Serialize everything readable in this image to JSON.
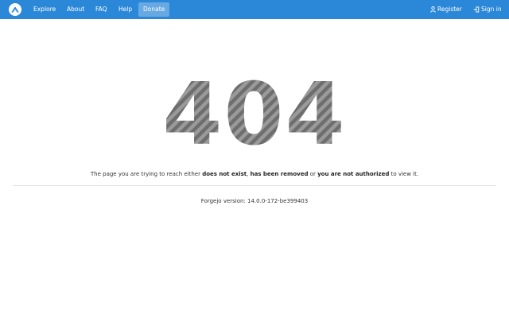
{
  "navbar": {
    "background": "#2b88d8",
    "logo_icon": "forgejo-logo-icon",
    "items": [
      {
        "label": "Explore"
      },
      {
        "label": "About"
      },
      {
        "label": "FAQ"
      },
      {
        "label": "Help"
      },
      {
        "label": "Donate",
        "active": true
      }
    ],
    "register_label": "Register",
    "register_icon": "person-icon",
    "signin_label": "Sign in",
    "signin_icon": "sign-in-icon"
  },
  "error": {
    "code": "404",
    "message_parts": [
      {
        "text": "The page you are trying to reach either ",
        "bold": false
      },
      {
        "text": "does not exist",
        "bold": true
      },
      {
        "text": ", ",
        "bold": false
      },
      {
        "text": "has been removed",
        "bold": true
      },
      {
        "text": " or ",
        "bold": false
      },
      {
        "text": "you are not authorized",
        "bold": true
      },
      {
        "text": " to view it.",
        "bold": false
      }
    ]
  },
  "footer": {
    "version": "Forgejo version: 14.0.0-172-be399403"
  }
}
